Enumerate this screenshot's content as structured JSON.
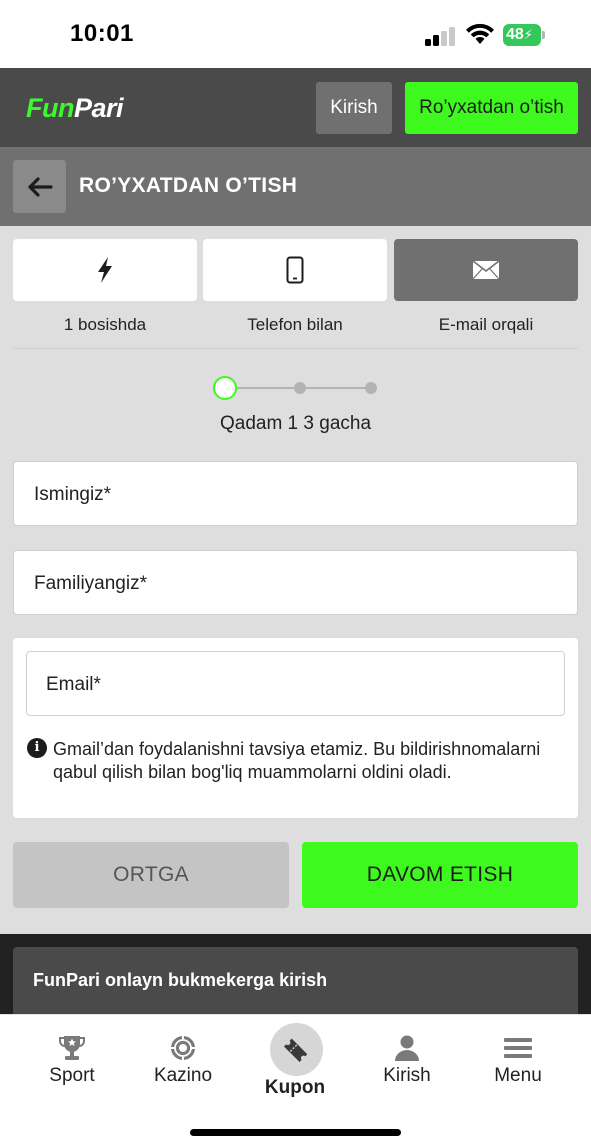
{
  "status_bar": {
    "time": "10:01",
    "battery": "48"
  },
  "header": {
    "logo_fun": "Fun",
    "logo_pari": "Pari",
    "login_label": "Kirish",
    "register_label": "Ro’yxatdan o’tish"
  },
  "title_bar": {
    "title": "RO’YXATDAN O’TISH",
    "back_icon": "arrow-left-icon"
  },
  "methods": [
    {
      "label": "1 bosishda",
      "icon": "lightning-icon",
      "active": false
    },
    {
      "label": "Telefon bilan",
      "icon": "phone-icon",
      "active": false
    },
    {
      "label": "E-mail orqali",
      "icon": "envelope-icon",
      "active": true
    }
  ],
  "stepper": {
    "current_step": 1,
    "total_steps": 3,
    "text": "Qadam 1 3 gacha"
  },
  "form": {
    "first_name_placeholder": "Ismingiz*",
    "last_name_placeholder": "Familiyangiz*",
    "email_placeholder": "Email*",
    "email_hint": "Gmail’dan foydalanishni tavsiya etamiz. Bu bildirishnomalarni qabul qilish bilan bog'liq muammolarni oldini oladi."
  },
  "actions": {
    "back_label": "ORTGA",
    "continue_label": "DAVOM ETISH"
  },
  "footer": {
    "accordion_title": "FunPari onlayn bukmekerga kirish"
  },
  "bottom_nav": [
    {
      "label": "Sport",
      "icon": "trophy-icon"
    },
    {
      "label": "Kazino",
      "icon": "casino-chip-icon"
    },
    {
      "label": "Kupon",
      "icon": "ticket-icon"
    },
    {
      "label": "Kirish",
      "icon": "user-icon"
    },
    {
      "label": "Menu",
      "icon": "hamburger-menu-icon"
    }
  ],
  "colors": {
    "accent": "#3df91d",
    "header_bg": "#4a4a4a",
    "title_bg": "#707070",
    "content_bg": "#dedede"
  }
}
